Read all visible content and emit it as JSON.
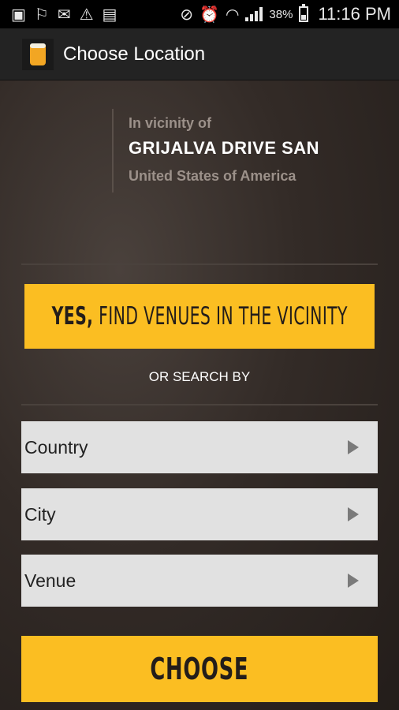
{
  "status_bar": {
    "battery_percent": "38%",
    "time": "11:16 PM",
    "icons": [
      "gallery-icon",
      "running-icon",
      "gmail-icon",
      "warning-icon",
      "tmobile-icon",
      "vibrate-mute-icon",
      "alarm-icon",
      "wifi-icon",
      "signal-icon",
      "battery-icon"
    ],
    "battery_level": 0.38
  },
  "action_bar": {
    "title": "Choose Location",
    "icon": "beer-glass-icon"
  },
  "vicinity": {
    "label": "In vicinity of",
    "street": "GRIJALVA DRIVE SAN",
    "country": "United States of America"
  },
  "yes_button": {
    "strong": "YES,",
    "rest": " FIND VENUES IN THE VICINITY"
  },
  "or_search_by": "OR SEARCH BY",
  "selects": [
    {
      "label": "Country",
      "icon": "triangle-right-icon"
    },
    {
      "label": "City",
      "icon": "triangle-right-icon"
    },
    {
      "label": "Venue",
      "icon": "triangle-right-icon"
    }
  ],
  "choose_button": {
    "label": "CHOOSE"
  },
  "colors": {
    "accent": "#fbbe22",
    "status_bar": "#000000",
    "action_bar": "#232323",
    "select_bg": "#e1e1e1",
    "muted_text": "#9c918a"
  }
}
